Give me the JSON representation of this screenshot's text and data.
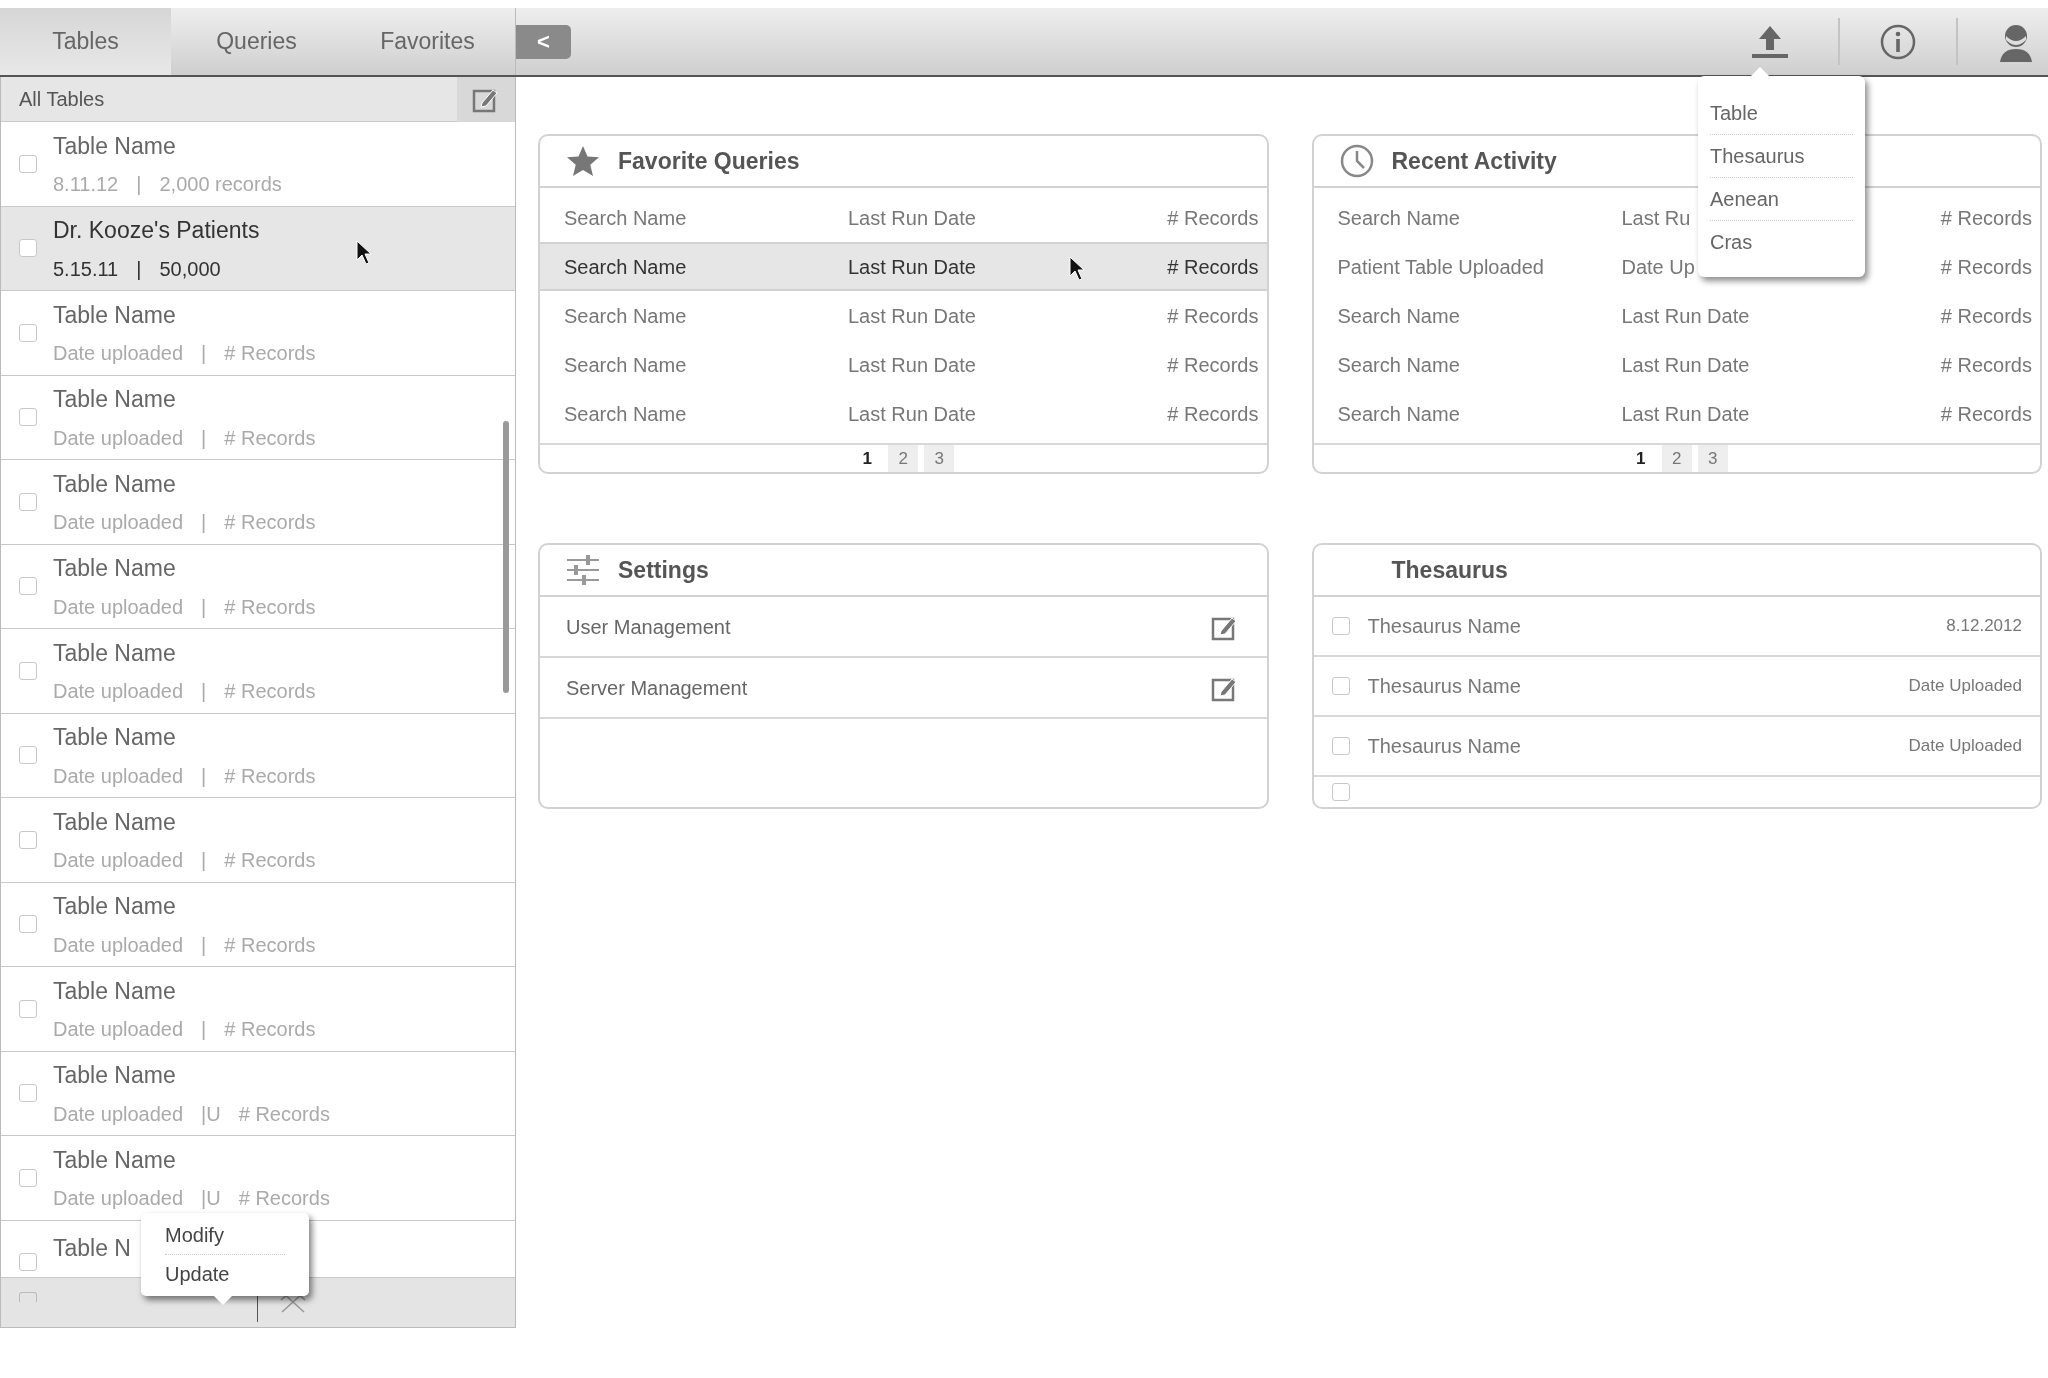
{
  "tabs": [
    {
      "label": "Tables",
      "selected": true
    },
    {
      "label": "Queries",
      "selected": false
    },
    {
      "label": "Favorites",
      "selected": false
    }
  ],
  "collapse_button": "<",
  "upload_menu": {
    "items": [
      "Table",
      "Thesaurus",
      "Aenean",
      "Cras"
    ]
  },
  "sidebar": {
    "header": "All Tables",
    "items": [
      {
        "title": "Table Name",
        "date": "8.11.12",
        "separator": "|",
        "records": "2,000 records",
        "selected": false,
        "checked": false
      },
      {
        "title": "Dr. Kooze's Patients",
        "date": "5.15.11",
        "separator": "|",
        "records": "50,000",
        "selected": true,
        "checked": false
      },
      {
        "title": "Table Name",
        "date": "Date uploaded",
        "separator": "|",
        "records": "# Records",
        "selected": false,
        "checked": false
      },
      {
        "title": "Table Name",
        "date": "Date uploaded",
        "separator": "|",
        "records": "# Records",
        "selected": false,
        "checked": false
      },
      {
        "title": "Table Name",
        "date": "Date uploaded",
        "separator": "|",
        "records": "# Records",
        "selected": false,
        "checked": false
      },
      {
        "title": "Table Name",
        "date": "Date uploaded",
        "separator": "|",
        "records": "# Records",
        "selected": false,
        "checked": false
      },
      {
        "title": "Table Name",
        "date": "Date uploaded",
        "separator": "|",
        "records": "# Records",
        "selected": false,
        "checked": false
      },
      {
        "title": "Table Name",
        "date": "Date uploaded",
        "separator": "|",
        "records": "# Records",
        "selected": false,
        "checked": false
      },
      {
        "title": "Table Name",
        "date": "Date uploaded",
        "separator": "|",
        "records": "# Records",
        "selected": false,
        "checked": false
      },
      {
        "title": "Table Name",
        "date": "Date uploaded",
        "separator": "|",
        "records": "# Records",
        "selected": false,
        "checked": false
      },
      {
        "title": "Table Name",
        "date": "Date uploaded",
        "separator": "|",
        "records": "# Records",
        "selected": false,
        "checked": false
      },
      {
        "title": "Table Name",
        "date": "Date uploaded",
        "separator": "|U",
        "records": "# Records",
        "selected": false,
        "checked": false
      },
      {
        "title": "Table Name",
        "date": "Date uploaded",
        "separator": "|U",
        "records": "# Records",
        "selected": false,
        "checked": false
      },
      {
        "title": "Table N",
        "selected": false,
        "checked": false
      }
    ],
    "context_menu": {
      "items": [
        "Modify",
        "Update"
      ]
    },
    "footer_checkbox": {
      "checked": false
    }
  },
  "favorite_queries": {
    "title": "Favorite Queries",
    "rows": [
      {
        "name": "Search Name",
        "date": "Last Run Date",
        "records": "# Records",
        "selected": false
      },
      {
        "name": "Search Name",
        "date": "Last Run Date",
        "records": "# Records",
        "selected": true
      },
      {
        "name": "Search Name",
        "date": "Last Run Date",
        "records": "# Records",
        "selected": false
      },
      {
        "name": "Search Name",
        "date": "Last Run Date",
        "records": "# Records",
        "selected": false
      },
      {
        "name": "Search Name",
        "date": "Last Run Date",
        "records": "# Records",
        "selected": false
      }
    ],
    "pages": [
      {
        "label": "1",
        "selected": true
      },
      {
        "label": "2",
        "selected": false
      },
      {
        "label": "3",
        "selected": false
      }
    ]
  },
  "recent_activity": {
    "title": "Recent Activity",
    "rows": [
      {
        "name": "Search Name",
        "date": "Last Ru",
        "records": "# Records"
      },
      {
        "name": "Patient Table Uploaded",
        "date": "Date Up",
        "records": "# Records"
      },
      {
        "name": "Search Name",
        "date": "Last Run Date",
        "records": "# Records"
      },
      {
        "name": "Search Name",
        "date": "Last Run Date",
        "records": "# Records"
      },
      {
        "name": "Search Name",
        "date": "Last Run Date",
        "records": "# Records"
      }
    ],
    "pages": [
      {
        "label": "1",
        "selected": true
      },
      {
        "label": "2",
        "selected": false
      },
      {
        "label": "3",
        "selected": false
      }
    ]
  },
  "settings": {
    "title": "Settings",
    "items": [
      "User Management",
      "Server Management"
    ]
  },
  "thesaurus": {
    "title": "Thesaurus",
    "rows": [
      {
        "name": "Thesaurus Name",
        "date": "8.12.2012",
        "checked": false
      },
      {
        "name": "Thesaurus Name",
        "date": "Date Uploaded",
        "checked": false
      },
      {
        "name": "Thesaurus Name",
        "date": "Date Uploaded",
        "checked": false
      },
      {
        "checked": false
      }
    ]
  }
}
